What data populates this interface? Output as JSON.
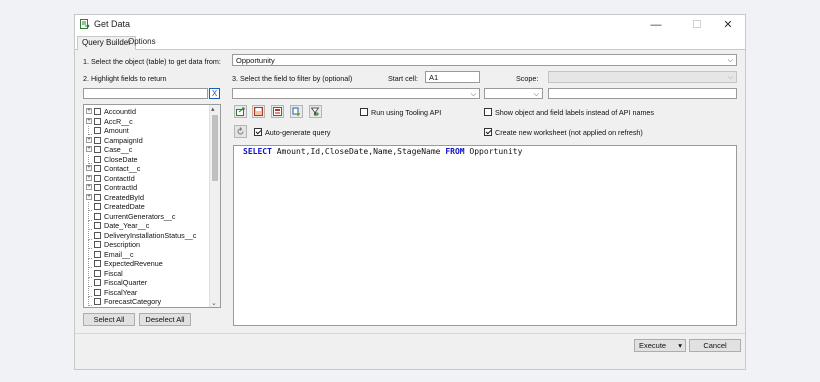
{
  "window": {
    "title": "Get Data",
    "minimize": "—",
    "maximize": "☐",
    "close": "✕"
  },
  "tabs": [
    {
      "label": "Query Builder"
    },
    {
      "label": "Options"
    }
  ],
  "object": {
    "label": "1. Select the object (table) to get data from:",
    "value": "Opportunity"
  },
  "highlight": {
    "label": "2. Highlight fields to return",
    "search_value": "",
    "clear_label": "X"
  },
  "filter": {
    "label": "3. Select the field to filter by (optional)",
    "field_value": "",
    "operator_value": "",
    "criteria_value": ""
  },
  "start_cell": {
    "label": "Start cell:",
    "value": "A1"
  },
  "scope": {
    "label": "Scope:",
    "value": ""
  },
  "fields": [
    {
      "name": "AccountId",
      "expandable": true
    },
    {
      "name": "AccR__c",
      "expandable": true
    },
    {
      "name": "Amount",
      "expandable": false
    },
    {
      "name": "CampaignId",
      "expandable": true
    },
    {
      "name": "Case__c",
      "expandable": true
    },
    {
      "name": "CloseDate",
      "expandable": false
    },
    {
      "name": "Contact__c",
      "expandable": true
    },
    {
      "name": "ContactId",
      "expandable": true
    },
    {
      "name": "ContractId",
      "expandable": true
    },
    {
      "name": "CreatedById",
      "expandable": true
    },
    {
      "name": "CreatedDate",
      "expandable": false
    },
    {
      "name": "CurrentGenerators__c",
      "expandable": false
    },
    {
      "name": "Date_Year__c",
      "expandable": false
    },
    {
      "name": "DeliveryInstallationStatus__c",
      "expandable": false
    },
    {
      "name": "Description",
      "expandable": false
    },
    {
      "name": "Email__c",
      "expandable": false
    },
    {
      "name": "ExpectedRevenue",
      "expandable": false
    },
    {
      "name": "Fiscal",
      "expandable": false
    },
    {
      "name": "FiscalQuarter",
      "expandable": false
    },
    {
      "name": "FiscalYear",
      "expandable": false
    },
    {
      "name": "ForecastCategory",
      "expandable": false
    }
  ],
  "options": {
    "tooling_api": {
      "label": "Run using Tooling API",
      "checked": false
    },
    "show_labels": {
      "label": "Show object and field labels instead of API names",
      "checked": false
    },
    "auto_generate": {
      "label": "Auto-generate query",
      "checked": true
    },
    "new_worksheet": {
      "label": "Create new worksheet (not applied on refresh)",
      "checked": true
    }
  },
  "query": {
    "select": "SELECT",
    "fields": "Amount,Id,CloseDate,Name,StageName",
    "from": "FROM",
    "object": "Opportunity"
  },
  "buttons": {
    "select_all": "Select All",
    "deselect_all": "Deselect All",
    "execute": "Execute",
    "execute_menu": "▾",
    "cancel": "Cancel"
  },
  "icons": [
    "export-icon",
    "save-icon",
    "load-icon",
    "add-filter-icon",
    "clear-filter-icon",
    "refresh-icon"
  ]
}
